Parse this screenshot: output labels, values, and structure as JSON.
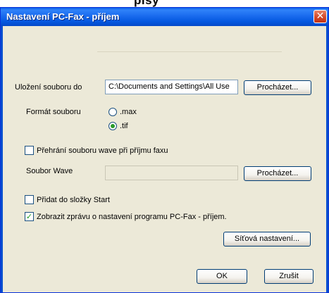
{
  "top_fragment": "pisy",
  "window": {
    "title": "Nastavení PC-Fax - příjem",
    "close_glyph": "✕"
  },
  "save_to": {
    "label": "Uložení souboru do",
    "value": "C:\\Documents and Settings\\All Use",
    "browse": "Procházet..."
  },
  "file_format": {
    "label": "Formát souboru",
    "options": [
      ".max",
      ".tif"
    ],
    "selected": ".tif"
  },
  "play_wave": {
    "label": "Přehrání souboru wave při příjmu faxu",
    "checked": false
  },
  "wave_file": {
    "label": "Soubor Wave",
    "value": "",
    "browse": "Procházet..."
  },
  "add_startup": {
    "label": "Přidat do složky Start",
    "checked": false
  },
  "show_message": {
    "label": "Zobrazit zprávu o nastavení programu PC-Fax - příjem.",
    "checked": true,
    "mark": "✓"
  },
  "network_button": "Síťová nastavení...",
  "ok_button": "OK",
  "cancel_button": "Zrušit",
  "colors": {
    "titlebar": "#0558e0",
    "dialog_bg": "#ece9d8",
    "close": "#d3492a"
  }
}
